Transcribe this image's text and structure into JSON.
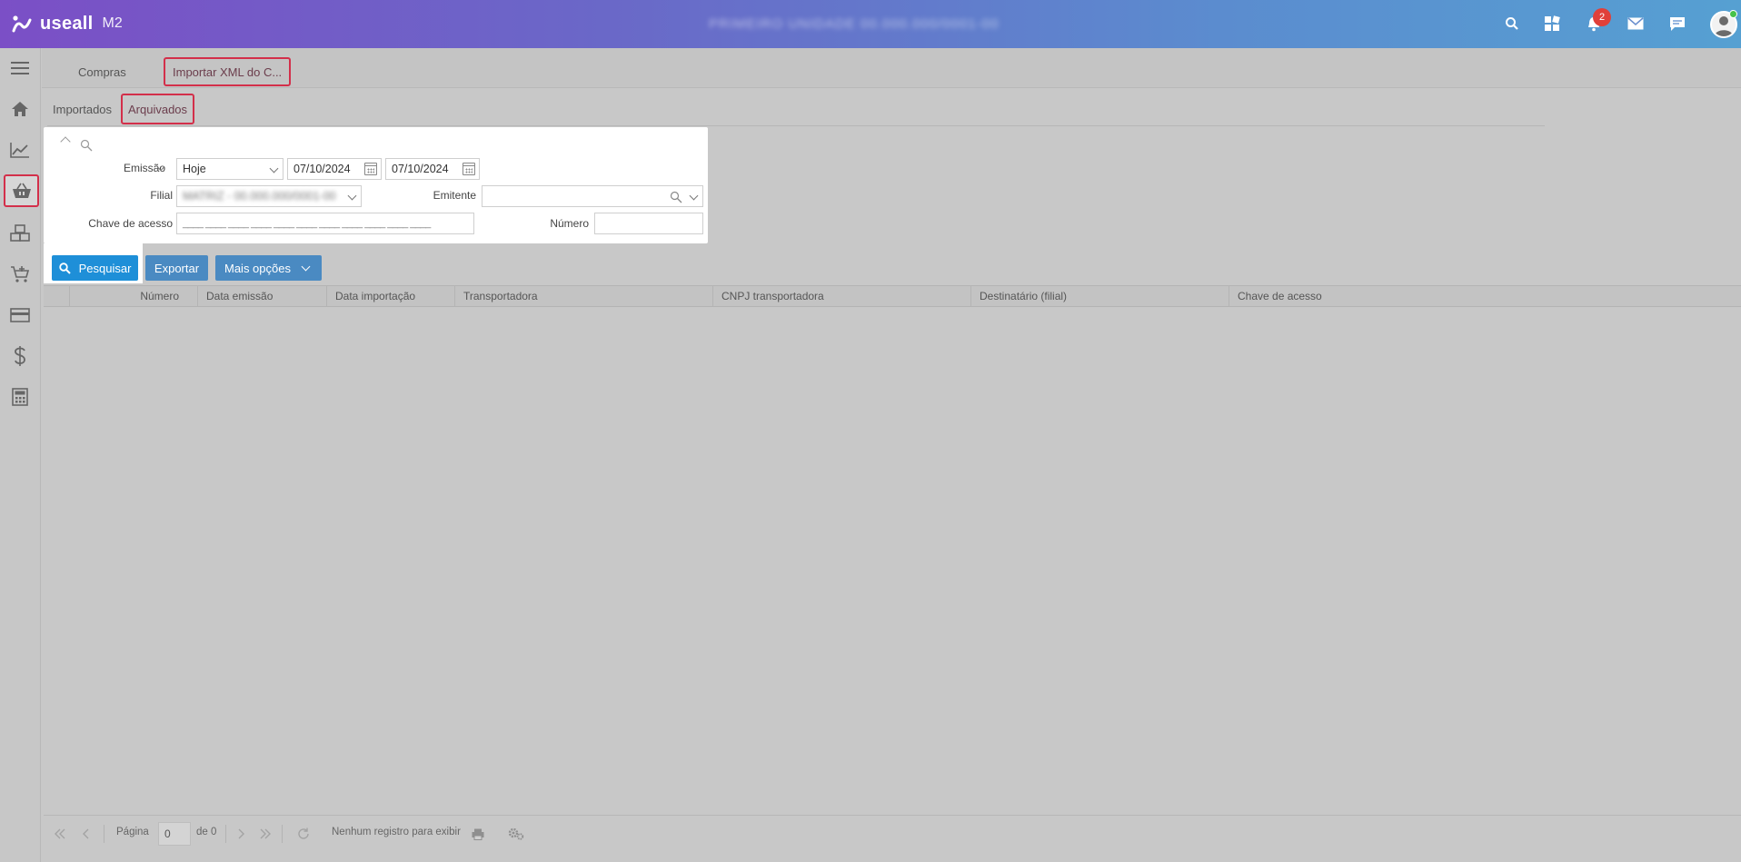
{
  "header": {
    "brand": "useall",
    "product": "M2",
    "context_blurred": "PRIMEIRO  UNIDADE  00.000.000/0001-00",
    "notification_count": "2",
    "colors": {
      "gradient_start": "#7b4fc6",
      "gradient_end": "#56a0d2",
      "badge": "#e0403a"
    }
  },
  "sidebar": {
    "items": [
      {
        "icon": "menu-icon"
      },
      {
        "icon": "home-icon"
      },
      {
        "icon": "chart-icon"
      },
      {
        "icon": "basket-icon",
        "active": true
      },
      {
        "icon": "boxes-icon"
      },
      {
        "icon": "cart-add-icon"
      },
      {
        "icon": "card-icon"
      },
      {
        "icon": "dollar-icon"
      },
      {
        "icon": "calculator-icon"
      }
    ]
  },
  "tabs": [
    {
      "label": "Compras"
    },
    {
      "label": "Importar XML do C..."
    }
  ],
  "subtabs": [
    {
      "label": "Importados"
    },
    {
      "label": "Arquivados"
    }
  ],
  "filter": {
    "emissao_label": "Emissão",
    "period_value": "Hoje",
    "date_from": "07/10/2024",
    "date_to": "07/10/2024",
    "filial_label": "Filial",
    "filial_value_blurred": "MATRIZ - 00.000.000/0001-00",
    "emitente_label": "Emitente",
    "emitente_value": "",
    "chave_label": "Chave de acesso",
    "chave_mask": "____ ____ ____ ____ ____ ____ ____ ____ ____ ____ ____",
    "numero_label": "Número",
    "numero_value": ""
  },
  "actions": {
    "search": "Pesquisar",
    "export": "Exportar",
    "more": "Mais opções"
  },
  "grid": {
    "columns": [
      "Número",
      "Data emissão",
      "Data importação",
      "Transportadora",
      "CNPJ transportadora",
      "Destinatário (filial)",
      "Chave de acesso"
    ],
    "rows": []
  },
  "pager": {
    "page_label": "Página",
    "page_value": "0",
    "of_label": "de 0",
    "status": "Nenhum registro para exibir"
  }
}
